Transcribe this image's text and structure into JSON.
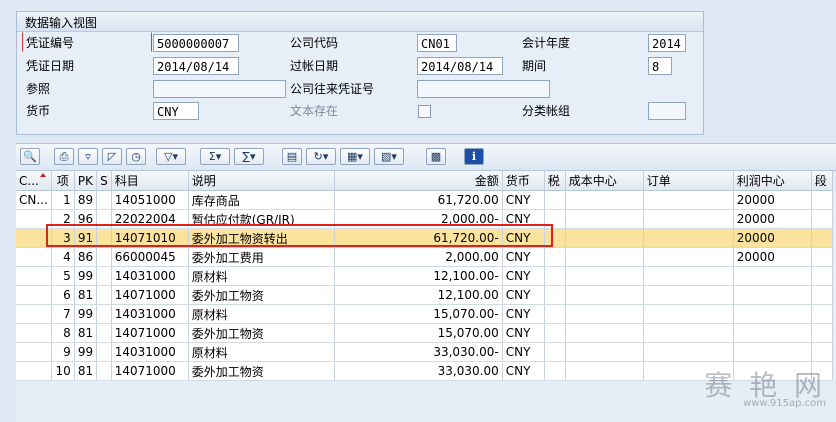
{
  "panel": {
    "title": "数据输入视图",
    "fields": {
      "voucher_no_label": "凭证编号",
      "voucher_no": "5000000007",
      "company_code_label": "公司代码",
      "company_code": "CN01",
      "fiscal_year_label": "会计年度",
      "fiscal_year": "2014",
      "doc_date_label": "凭证日期",
      "doc_date": "2014/08/14",
      "posting_date_label": "过帐日期",
      "posting_date": "2014/08/14",
      "period_label": "期间",
      "period": "8",
      "reference_label": "参照",
      "reference": "",
      "cross_company_label": "公司往来凭证号",
      "cross_company": "",
      "currency_label": "货币",
      "currency": "CNY",
      "text_exists_label": "文本存在",
      "ledger_group_label": "分类帐组",
      "ledger_group": ""
    }
  },
  "toolbar": {
    "buttons": [
      "details-icon",
      "print-icon",
      "filter-icon",
      "find-icon",
      "find-next-icon",
      "set-filter-icon",
      "sum-icon",
      "subtotal-icon",
      "print-preview-icon",
      "export-icon",
      "view-icon",
      "layout-icon",
      "graphic-icon",
      "info-icon"
    ]
  },
  "table": {
    "headers": [
      "C...",
      "项",
      "PK",
      "S",
      "科目",
      "说明",
      "金额",
      "货币",
      "税",
      "成本中心",
      "订单",
      "利润中心",
      "段"
    ],
    "rows": [
      [
        "CN...",
        "1",
        "89",
        "",
        "14051000",
        "库存商品",
        "61,720.00",
        "CNY",
        "",
        "",
        "",
        "20000",
        ""
      ],
      [
        "",
        "2",
        "96",
        "",
        "22022004",
        "暂估应付款(GR/IR)",
        "2,000.00-",
        "CNY",
        "",
        "",
        "",
        "20000",
        ""
      ],
      [
        "",
        "3",
        "91",
        "",
        "14071010",
        "委外加工物资转出",
        "61,720.00-",
        "CNY",
        "",
        "",
        "",
        "20000",
        ""
      ],
      [
        "",
        "4",
        "86",
        "",
        "66000045",
        "委外加工费用",
        "2,000.00",
        "CNY",
        "",
        "",
        "",
        "20000",
        ""
      ],
      [
        "",
        "5",
        "99",
        "",
        "14031000",
        "原材料",
        "12,100.00-",
        "CNY",
        "",
        "",
        "",
        "",
        ""
      ],
      [
        "",
        "6",
        "81",
        "",
        "14071000",
        "委外加工物资",
        "12,100.00",
        "CNY",
        "",
        "",
        "",
        "",
        ""
      ],
      [
        "",
        "7",
        "99",
        "",
        "14031000",
        "原材料",
        "15,070.00-",
        "CNY",
        "",
        "",
        "",
        "",
        ""
      ],
      [
        "",
        "8",
        "81",
        "",
        "14071000",
        "委外加工物资",
        "15,070.00",
        "CNY",
        "",
        "",
        "",
        "",
        ""
      ],
      [
        "",
        "9",
        "99",
        "",
        "14031000",
        "原材料",
        "33,030.00-",
        "CNY",
        "",
        "",
        "",
        "",
        ""
      ],
      [
        "",
        "10",
        "81",
        "",
        "14071000",
        "委外加工物资",
        "33,030.00",
        "CNY",
        "",
        "",
        "",
        "",
        ""
      ]
    ],
    "selected_row": 2
  },
  "watermark": {
    "main": "赛 艳 网",
    "sub": "www.915ap.com"
  },
  "colors": {
    "highlight": "#fbe39e",
    "annotation": "#e0221c",
    "background": "#dfe9f5"
  }
}
